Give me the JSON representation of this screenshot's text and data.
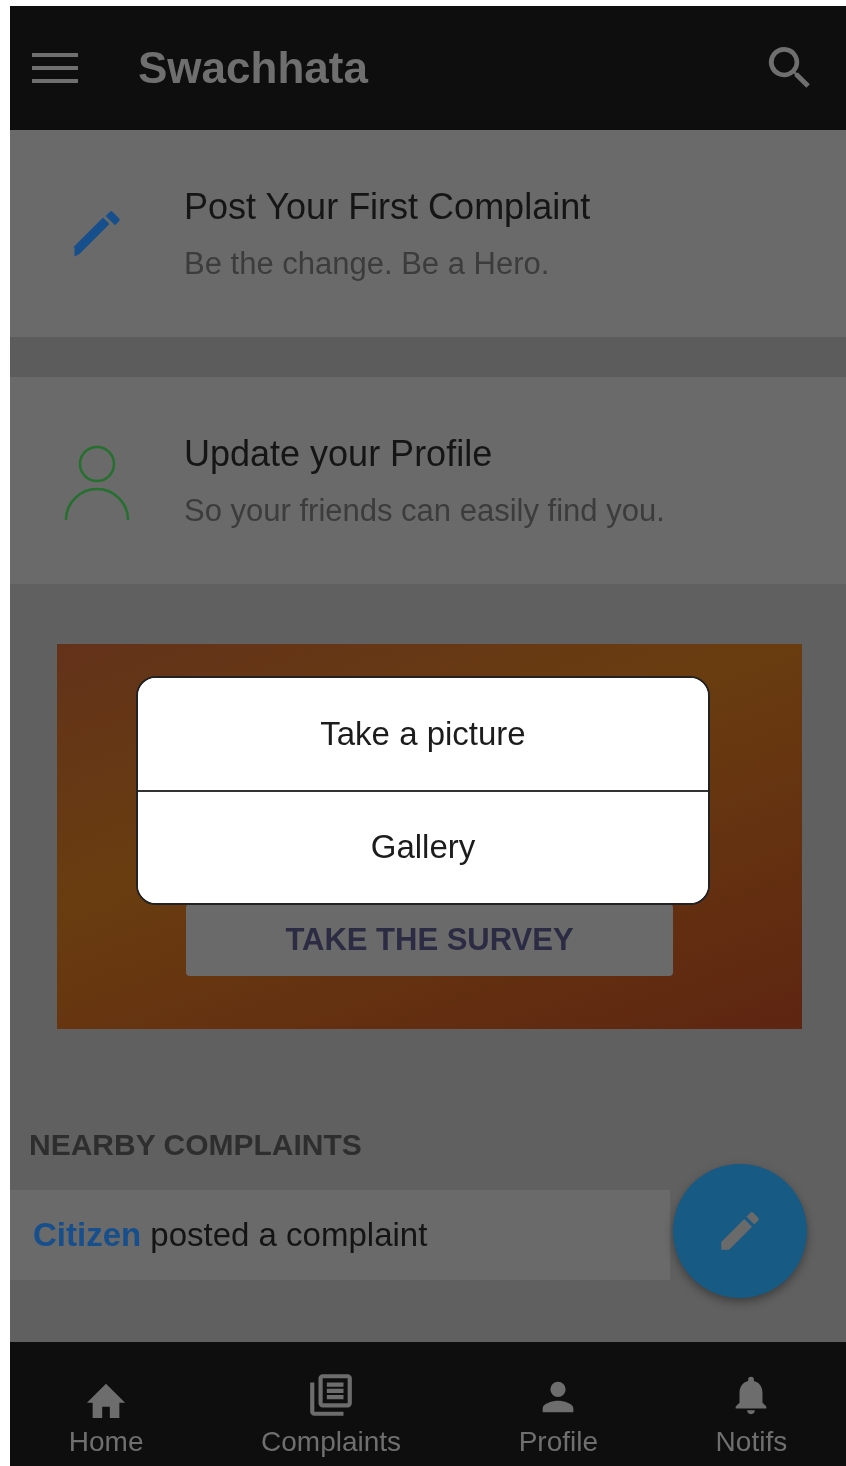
{
  "app_bar": {
    "title": "Swachhata"
  },
  "cards": [
    {
      "kind": "pencil",
      "title": "Post Your First Complaint",
      "subtitle": "Be the change. Be a Hero."
    },
    {
      "kind": "person",
      "title": "Update your Profile",
      "subtitle": "So your friends can easily find you."
    }
  ],
  "banner": {
    "button": "TAKE THE SURVEY"
  },
  "section_title": "NEARBY COMPLAINTS",
  "feed": [
    {
      "author": "Citizen",
      "action": "posted a complaint"
    }
  ],
  "dialog": {
    "options": [
      "Take a picture",
      "Gallery"
    ]
  },
  "bottom_nav": [
    {
      "kind": "home",
      "label": "Home"
    },
    {
      "kind": "list",
      "label": "Complaints"
    },
    {
      "kind": "person",
      "label": "Profile"
    },
    {
      "kind": "bell",
      "label": "Notifs"
    }
  ]
}
